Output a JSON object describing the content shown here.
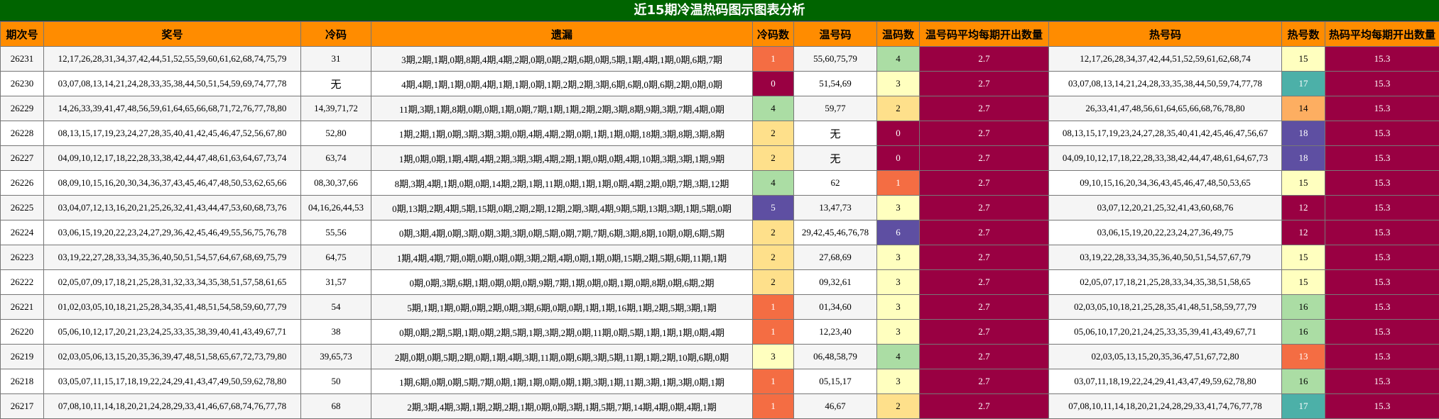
{
  "title": "近15期冷温热码图示图表分析",
  "columns": [
    "期次号",
    "奖号",
    "冷码",
    "遗漏",
    "冷码数",
    "温号码",
    "温码数",
    "温号码平均每期开出数量",
    "热号码",
    "热号数",
    "热码平均每期开出数量"
  ],
  "colors": {
    "title_bg": "#006400",
    "header_bg": "#ff8c00",
    "avg_bg": "#990042",
    "count_colors": {
      "0": "#990042",
      "1": "#f46d43",
      "2": "#fee08b",
      "3": "#ffffbf",
      "4": "#abdda4",
      "5": "#5e4fa2",
      "6": "#5e4fa2",
      "12": "#990042",
      "13": "#f46d43",
      "14": "#fdae61",
      "15": "#ffffbf",
      "16": "#abdda4",
      "17": "#4cb0a8",
      "18": "#5e4fa2"
    }
  },
  "rows": [
    {
      "issue": "26231",
      "numbers": "12,17,26,28,31,34,37,42,44,51,52,55,59,60,61,62,68,74,75,79",
      "cold": "31",
      "miss": "3期,2期,1期,0期,8期,4期,4期,2期,0期,0期,2期,6期,0期,5期,1期,4期,1期,0期,6期,7期",
      "cold_count": 1,
      "warm": "55,60,75,79",
      "warm_count": 4,
      "warm_avg": "2.7",
      "hot": "12,17,26,28,34,37,42,44,51,52,59,61,62,68,74",
      "hot_count": 15,
      "hot_avg": "15.3"
    },
    {
      "issue": "26230",
      "numbers": "03,07,08,13,14,21,24,28,33,35,38,44,50,51,54,59,69,74,77,78",
      "cold": "无",
      "miss": "4期,4期,1期,1期,0期,4期,1期,1期,0期,1期,2期,2期,3期,6期,6期,0期,6期,2期,0期,0期",
      "cold_count": 0,
      "warm": "51,54,69",
      "warm_count": 3,
      "warm_avg": "2.7",
      "hot": "03,07,08,13,14,21,24,28,33,35,38,44,50,59,74,77,78",
      "hot_count": 17,
      "hot_avg": "15.3"
    },
    {
      "issue": "26229",
      "numbers": "14,26,33,39,41,47,48,56,59,61,64,65,66,68,71,72,76,77,78,80",
      "cold": "14,39,71,72",
      "miss": "11期,3期,1期,8期,0期,0期,1期,0期,7期,1期,1期,2期,2期,3期,8期,9期,3期,7期,4期,0期",
      "cold_count": 4,
      "warm": "59,77",
      "warm_count": 2,
      "warm_avg": "2.7",
      "hot": "26,33,41,47,48,56,61,64,65,66,68,76,78,80",
      "hot_count": 14,
      "hot_avg": "15.3"
    },
    {
      "issue": "26228",
      "numbers": "08,13,15,17,19,23,24,27,28,35,40,41,42,45,46,47,52,56,67,80",
      "cold": "52,80",
      "miss": "1期,2期,1期,0期,3期,3期,3期,0期,4期,4期,2期,0期,1期,1期,0期,18期,3期,8期,3期,8期",
      "cold_count": 2,
      "warm": "无",
      "warm_count": 0,
      "warm_avg": "2.7",
      "hot": "08,13,15,17,19,23,24,27,28,35,40,41,42,45,46,47,56,67",
      "hot_count": 18,
      "hot_avg": "15.3"
    },
    {
      "issue": "26227",
      "numbers": "04,09,10,12,17,18,22,28,33,38,42,44,47,48,61,63,64,67,73,74",
      "cold": "63,74",
      "miss": "1期,0期,0期,1期,4期,4期,2期,3期,3期,4期,2期,1期,0期,0期,4期,10期,3期,3期,1期,9期",
      "cold_count": 2,
      "warm": "无",
      "warm_count": 0,
      "warm_avg": "2.7",
      "hot": "04,09,10,12,17,18,22,28,33,38,42,44,47,48,61,64,67,73",
      "hot_count": 18,
      "hot_avg": "15.3"
    },
    {
      "issue": "26226",
      "numbers": "08,09,10,15,16,20,30,34,36,37,43,45,46,47,48,50,53,62,65,66",
      "cold": "08,30,37,66",
      "miss": "8期,3期,4期,1期,0期,0期,14期,2期,1期,11期,0期,1期,1期,0期,4期,2期,0期,7期,3期,12期",
      "cold_count": 4,
      "warm": "62",
      "warm_count": 1,
      "warm_avg": "2.7",
      "hot": "09,10,15,16,20,34,36,43,45,46,47,48,50,53,65",
      "hot_count": 15,
      "hot_avg": "15.3"
    },
    {
      "issue": "26225",
      "numbers": "03,04,07,12,13,16,20,21,25,26,32,41,43,44,47,53,60,68,73,76",
      "cold": "04,16,26,44,53",
      "miss": "0期,13期,2期,4期,5期,15期,0期,2期,2期,12期,2期,3期,4期,9期,5期,13期,3期,1期,5期,0期",
      "cold_count": 5,
      "warm": "13,47,73",
      "warm_count": 3,
      "warm_avg": "2.7",
      "hot": "03,07,12,20,21,25,32,41,43,60,68,76",
      "hot_count": 12,
      "hot_avg": "15.3"
    },
    {
      "issue": "26224",
      "numbers": "03,06,15,19,20,22,23,24,27,29,36,42,45,46,49,55,56,75,76,78",
      "cold": "55,56",
      "miss": "0期,3期,4期,0期,3期,0期,3期,3期,0期,5期,0期,7期,7期,6期,3期,8期,10期,0期,6期,5期",
      "cold_count": 2,
      "warm": "29,42,45,46,76,78",
      "warm_count": 6,
      "warm_avg": "2.7",
      "hot": "03,06,15,19,20,22,23,24,27,36,49,75",
      "hot_count": 12,
      "hot_avg": "15.3"
    },
    {
      "issue": "26223",
      "numbers": "03,19,22,27,28,33,34,35,36,40,50,51,54,57,64,67,68,69,75,79",
      "cold": "64,75",
      "miss": "1期,4期,4期,7期,0期,0期,0期,0期,3期,2期,4期,0期,1期,0期,15期,2期,5期,6期,11期,1期",
      "cold_count": 2,
      "warm": "27,68,69",
      "warm_count": 3,
      "warm_avg": "2.7",
      "hot": "03,19,22,28,33,34,35,36,40,50,51,54,57,67,79",
      "hot_count": 15,
      "hot_avg": "15.3"
    },
    {
      "issue": "26222",
      "numbers": "02,05,07,09,17,18,21,25,28,31,32,33,34,35,38,51,57,58,61,65",
      "cold": "31,57",
      "miss": "0期,0期,3期,6期,1期,0期,0期,0期,9期,7期,1期,0期,0期,1期,0期,8期,0期,6期,2期",
      "cold_count": 2,
      "warm": "09,32,61",
      "warm_count": 3,
      "warm_avg": "2.7",
      "hot": "02,05,07,17,18,21,25,28,33,34,35,38,51,58,65",
      "hot_count": 15,
      "hot_avg": "15.3"
    },
    {
      "issue": "26221",
      "numbers": "01,02,03,05,10,18,21,25,28,34,35,41,48,51,54,58,59,60,77,79",
      "cold": "54",
      "miss": "5期,1期,1期,0期,0期,2期,0期,3期,6期,0期,0期,1期,1期,16期,1期,2期,5期,3期,1期",
      "cold_count": 1,
      "warm": "01,34,60",
      "warm_count": 3,
      "warm_avg": "2.7",
      "hot": "02,03,05,10,18,21,25,28,35,41,48,51,58,59,77,79",
      "hot_count": 16,
      "hot_avg": "15.3"
    },
    {
      "issue": "26220",
      "numbers": "05,06,10,12,17,20,21,23,24,25,33,35,38,39,40,41,43,49,67,71",
      "cold": "38",
      "miss": "0期,0期,2期,5期,1期,0期,2期,5期,1期,3期,2期,0期,11期,0期,5期,1期,1期,1期,0期,4期",
      "cold_count": 1,
      "warm": "12,23,40",
      "warm_count": 3,
      "warm_avg": "2.7",
      "hot": "05,06,10,17,20,21,24,25,33,35,39,41,43,49,67,71",
      "hot_count": 16,
      "hot_avg": "15.3"
    },
    {
      "issue": "26219",
      "numbers": "02,03,05,06,13,15,20,35,36,39,47,48,51,58,65,67,72,73,79,80",
      "cold": "39,65,73",
      "miss": "2期,0期,0期,5期,2期,0期,1期,4期,3期,11期,0期,6期,3期,5期,11期,1期,2期,10期,6期,0期",
      "cold_count": 3,
      "warm": "06,48,58,79",
      "warm_count": 4,
      "warm_avg": "2.7",
      "hot": "02,03,05,13,15,20,35,36,47,51,67,72,80",
      "hot_count": 13,
      "hot_avg": "15.3"
    },
    {
      "issue": "26218",
      "numbers": "03,05,07,11,15,17,18,19,22,24,29,41,43,47,49,50,59,62,78,80",
      "cold": "50",
      "miss": "1期,6期,0期,0期,5期,7期,0期,1期,1期,0期,0期,1期,3期,1期,11期,3期,1期,3期,0期,1期",
      "cold_count": 1,
      "warm": "05,15,17",
      "warm_count": 3,
      "warm_avg": "2.7",
      "hot": "03,07,11,18,19,22,24,29,41,43,47,49,59,62,78,80",
      "hot_count": 16,
      "hot_avg": "15.3"
    },
    {
      "issue": "26217",
      "numbers": "07,08,10,11,14,18,20,21,24,28,29,33,41,46,67,68,74,76,77,78",
      "cold": "68",
      "miss": "2期,3期,4期,3期,1期,2期,2期,1期,0期,0期,3期,1期,5期,7期,14期,4期,0期,4期,1期",
      "cold_count": 1,
      "warm": "46,67",
      "warm_count": 2,
      "warm_avg": "2.7",
      "hot": "07,08,10,11,14,18,20,21,24,28,29,33,41,74,76,77,78",
      "hot_count": 17,
      "hot_avg": "15.3"
    }
  ]
}
